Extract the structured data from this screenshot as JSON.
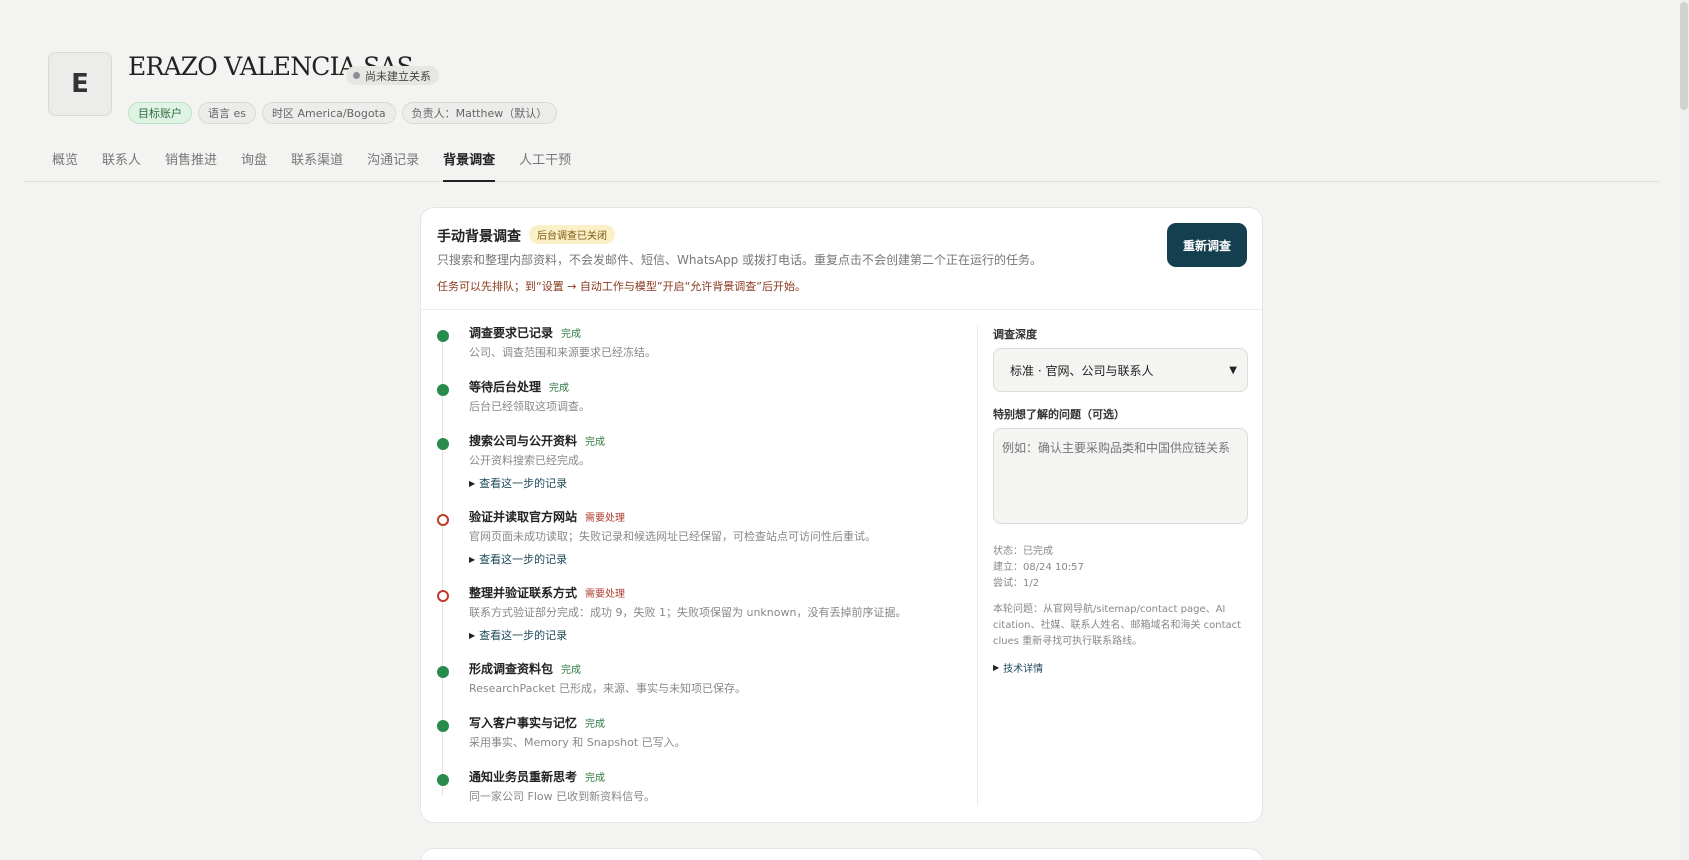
{
  "account": {
    "avatar_letter": "E",
    "name": "ERAZO VALENCIA SAS",
    "relation_status": "尚未建立关系",
    "tags": [
      "目标账户",
      "语言 es",
      "时区 America/Bogota",
      "负责人：Matthew（默认）"
    ]
  },
  "tabs": [
    "概览",
    "联系人",
    "销售推进",
    "询盘",
    "联系渠道",
    "沟通记录",
    "背景调查",
    "人工干预"
  ],
  "active_tab": "背景调查",
  "research": {
    "title": "手动背景调查",
    "badge": "后台调查已关闭",
    "description": "只搜索和整理内部资料，不会发邮件、短信、WhatsApp 或拨打电话。重复点击不会创建第二个正在运行的任务。",
    "warning": "任务可以先排队；到“设置 → 自动工作与模型”开启“允许背景调查”后开始。",
    "rerun_label": "重新调查",
    "log_label": "查看这一步的记录",
    "steps": [
      {
        "title": "调查要求已记录",
        "status": "完成",
        "desc": "公司、调查范围和来源要求已经冻结。"
      },
      {
        "title": "等待后台处理",
        "status": "完成",
        "desc": "后台已经领取这项调查。"
      },
      {
        "title": "搜索公司与公开资料",
        "status": "完成",
        "desc": "公开资料搜索已经完成。"
      },
      {
        "title": "验证并读取官方网站",
        "status": "需要处理",
        "desc": "官网页面未成功读取；失败记录和候选网址已经保留，可检查站点可访问性后重试。"
      },
      {
        "title": "整理并验证联系方式",
        "status": "需要处理",
        "desc": "联系方式验证部分完成：成功 9，失败 1；失败项保留为 unknown，没有丢掉前序证据。"
      },
      {
        "title": "形成调查资料包",
        "status": "完成",
        "desc": "ResearchPacket 已形成，来源、事实与未知项已保存。"
      },
      {
        "title": "写入客户事实与记忆",
        "status": "完成",
        "desc": "采用事实、Memory 和 Snapshot 已写入。"
      },
      {
        "title": "通知业务员重新思考",
        "status": "完成",
        "desc": "同一家公司 Flow 已收到新资料信号。"
      }
    ]
  },
  "sidebar": {
    "depth_label": "调查深度",
    "depth_value": "标准 · 官网、公司与联系人",
    "question_label": "特别想了解的问题（可选）",
    "question_placeholder": "例如：确认主要采购品类和中国供应链关系",
    "status_line": "状态：已完成",
    "created_line": "建立：08/24 10:57",
    "attempt_line": "尝试：1/2",
    "note": "本轮问题：从官网导航/sitemap/contact page、AI citation、社媒、联系人姓名、邮箱域名和海关 contact clues 重新寻找可执行联系路线。",
    "tech_details": "技术详情"
  },
  "colors": {
    "accent": "#143f4f",
    "done": "#2a8a4b",
    "warn": "#c0392b"
  }
}
